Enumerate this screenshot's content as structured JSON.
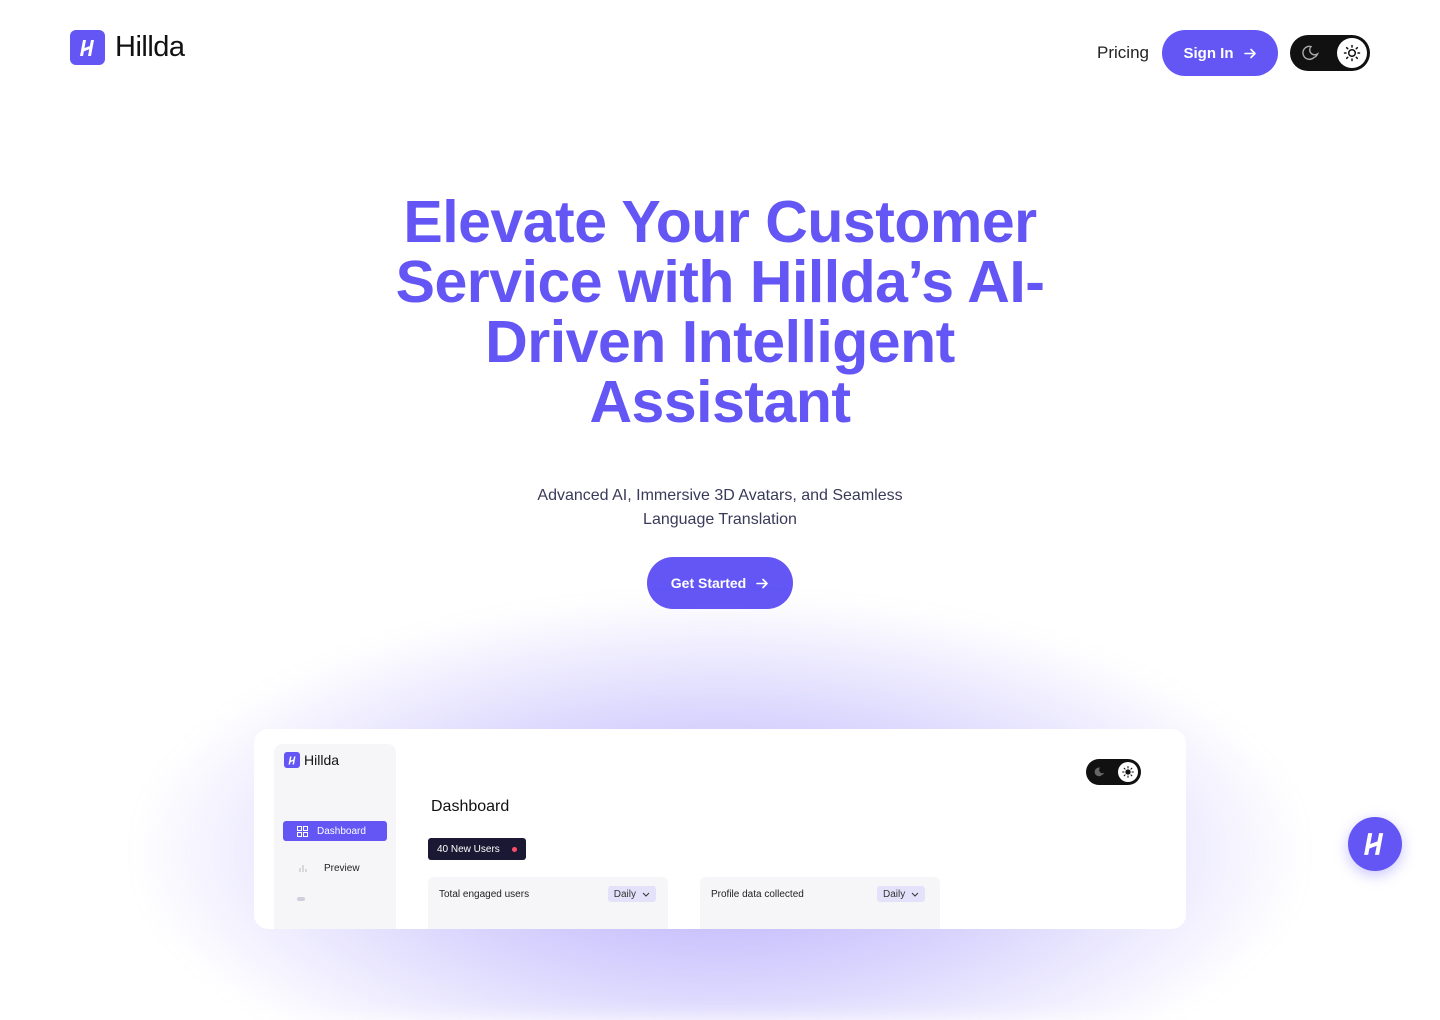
{
  "brand": {
    "name": "Hillda",
    "accent_color": "#6356f5",
    "logo_icon": "hillda-h-logo-icon"
  },
  "nav": {
    "pricing_label": "Pricing",
    "signin_label": "Sign In",
    "signin_icon": "arrow-right-icon",
    "theme_toggle": {
      "modes": [
        "moon-icon",
        "sun-icon"
      ],
      "selected": "light"
    }
  },
  "hero": {
    "title": "Elevate Your Customer Service with Hillda’s AI-Driven Intelligent Assistant",
    "subtitle": "Advanced AI, Immersive 3D Avatars, and Seamless Language Translation",
    "cta_label": "Get Started",
    "cta_icon": "arrow-right-icon"
  },
  "dashboard_preview": {
    "logo_text": "Hillda",
    "sidebar": [
      {
        "label": "Dashboard",
        "icon": "grid-icon",
        "active": true
      },
      {
        "label": "Preview",
        "icon": "bar-chart-icon",
        "active": false
      }
    ],
    "title": "Dashboard",
    "badge": "40 New Users",
    "badge_dot_color": "#ff4d6d",
    "cards": [
      {
        "label": "Total engaged users",
        "period": "Daily"
      },
      {
        "label": "Profile data collected",
        "period": "Daily"
      }
    ]
  },
  "assistant_fab": {
    "icon": "hillda-h-logo-icon"
  }
}
